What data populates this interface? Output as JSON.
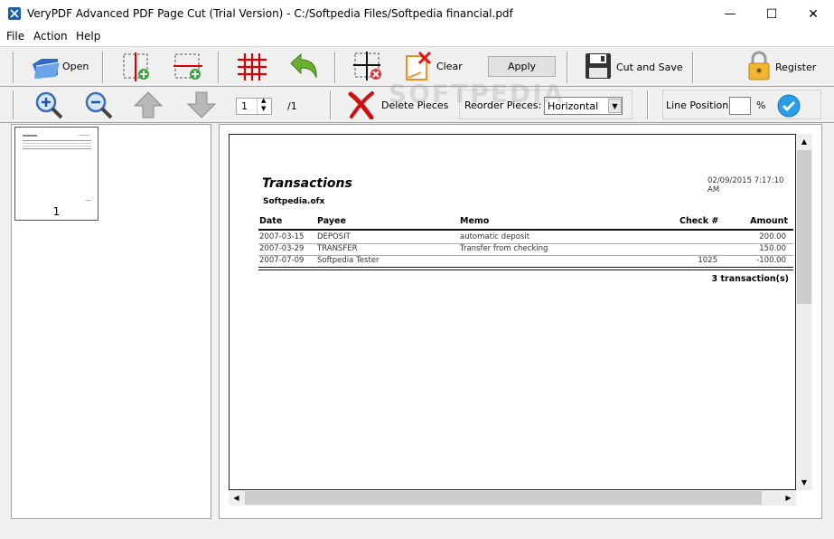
{
  "window": {
    "title": "VeryPDF Advanced PDF Page Cut (Trial Version) - C:/Softpedia Files/Softpedia financial.pdf",
    "minimize": "—",
    "maximize": "☐",
    "close": "✕"
  },
  "menu": [
    "File",
    "Action",
    "Help"
  ],
  "toolbar1": {
    "open": "Open",
    "clear": "Clear",
    "apply": "Apply",
    "cut_and_save": "Cut and Save",
    "register": "Register"
  },
  "toolbar2": {
    "page_value": "1",
    "page_total": "/1",
    "delete_pieces": "Delete Pieces",
    "reorder_label": "Reorder Pieces:",
    "reorder_value": "Horizontal",
    "line_position_label": "Line Position :",
    "line_position_value": "",
    "percent": "%"
  },
  "thumbnail": {
    "page_label": "1"
  },
  "document": {
    "title": "Transactions",
    "subtitle": "Softpedia.ofx",
    "timestamp": "02/09/2015 7:17:10 AM",
    "columns": [
      "Date",
      "Payee",
      "Memo",
      "Check #",
      "Amount"
    ],
    "rows": [
      [
        "2007-03-15",
        "DEPOSIT",
        "automatic deposit",
        "",
        "200.00"
      ],
      [
        "2007-03-29",
        "TRANSFER",
        "Transfer from checking",
        "",
        "150.00"
      ],
      [
        "2007-07-09",
        "Softpedia Tester",
        "",
        "1025",
        "-100.00"
      ]
    ],
    "summary": "3 transaction(s)"
  },
  "watermark": "SOFTPEDIA"
}
